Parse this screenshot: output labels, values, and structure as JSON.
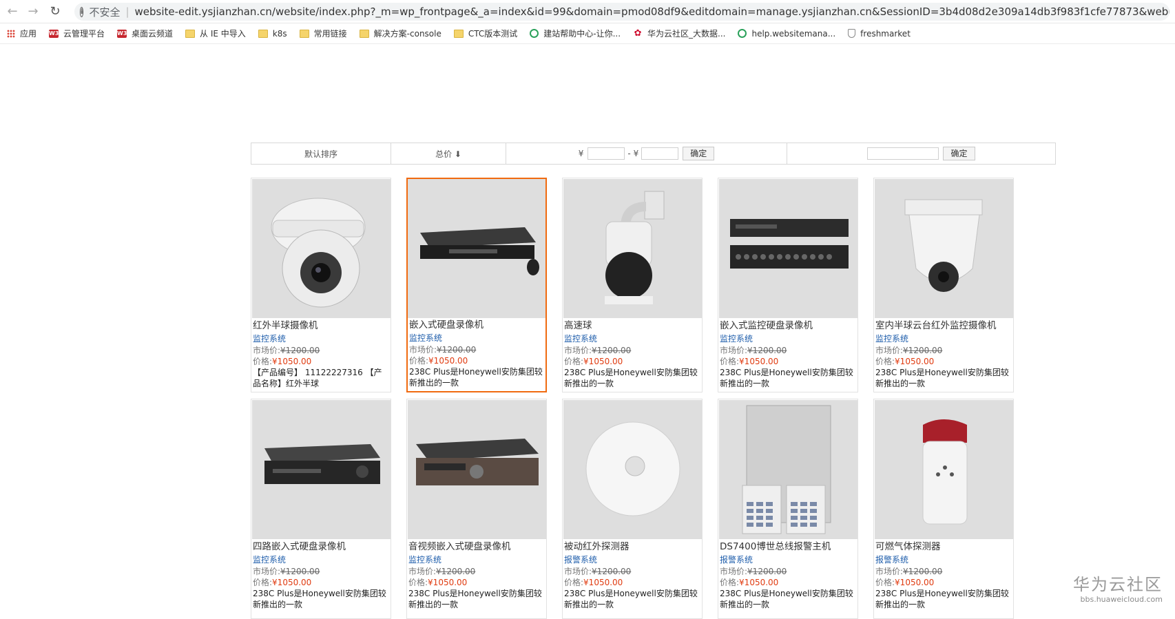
{
  "browser": {
    "insecure_label": "不安全",
    "url": "website-edit.ysjianzhan.cn/website/index.php?_m=wp_frontpage&_a=index&id=99&domain=pmod08df9&editdomain=manage.ysjianzhan.cn&SessionID=3b4d08d2e309a14db3f983f1cfe77873&webmtype=&_v=preview"
  },
  "bookmarks": [
    {
      "label": "应用",
      "icon": "apps-icon"
    },
    {
      "label": "云管理平台",
      "icon": "w3-icon"
    },
    {
      "label": "桌面云频道",
      "icon": "w3-icon"
    },
    {
      "label": "从 IE 中导入",
      "icon": "folder-icon"
    },
    {
      "label": "k8s",
      "icon": "folder-icon"
    },
    {
      "label": "常用链接",
      "icon": "folder-icon"
    },
    {
      "label": "解决方案-console",
      "icon": "folder-icon"
    },
    {
      "label": "CTC版本测试",
      "icon": "folder-icon"
    },
    {
      "label": "建站帮助中心-让你...",
      "icon": "search-icon"
    },
    {
      "label": "华为云社区_大数据...",
      "icon": "huawei-icon"
    },
    {
      "label": "help.websitemana...",
      "icon": "search-icon"
    },
    {
      "label": "freshmarket",
      "icon": "shield-icon"
    }
  ],
  "filter": {
    "default_sort": "默认排序",
    "total_price": "总价 ⬇",
    "currency_from": "¥",
    "currency_to": "- ¥",
    "confirm_price": "确定",
    "confirm_search": "确定"
  },
  "products": [
    {
      "name": "红外半球摄像机",
      "category": "监控系统",
      "market_label": "市场价:",
      "market_price": "¥1200.00",
      "price_label": "价格:",
      "price": "¥1050.00",
      "desc": "【产品编号】 11122227316 【产品名称】红外半球",
      "image": "dome-camera"
    },
    {
      "name": "嵌入式硬盘录像机",
      "category": "监控系统",
      "market_label": "市场价:",
      "market_price": "¥1200.00",
      "price_label": "价格:",
      "price": "¥1050.00",
      "desc": "238C Plus是Honeywell安防集团较新推出的一款",
      "image": "dvr-mouse"
    },
    {
      "name": "高速球",
      "category": "监控系统",
      "market_label": "市场价:",
      "market_price": "¥1200.00",
      "price_label": "价格:",
      "price": "¥1050.00",
      "desc": "238C Plus是Honeywell安防集团较新推出的一款",
      "image": "speed-dome"
    },
    {
      "name": "嵌入式监控硬盘录像机",
      "category": "监控系统",
      "market_label": "市场价:",
      "market_price": "¥1200.00",
      "price_label": "价格:",
      "price": "¥1050.00",
      "desc": "238C Plus是Honeywell安防集团较新推出的一款",
      "image": "dvr-stack"
    },
    {
      "name": "室内半球云台红外监控摄像机",
      "category": "监控系统",
      "market_label": "市场价:",
      "market_price": "¥1200.00",
      "price_label": "价格:",
      "price": "¥1050.00",
      "desc": "238C Plus是Honeywell安防集团较新推出的一款",
      "image": "indoor-camera"
    },
    {
      "name": "四路嵌入式硬盘录像机",
      "category": "监控系统",
      "market_label": "市场价:",
      "market_price": "¥1200.00",
      "price_label": "价格:",
      "price": "¥1050.00",
      "desc": "238C Plus是Honeywell安防集团较新推出的一款",
      "image": "dvr-black"
    },
    {
      "name": "音视频嵌入式硬盘录像机",
      "category": "监控系统",
      "market_label": "市场价:",
      "market_price": "¥1200.00",
      "price_label": "价格:",
      "price": "¥1050.00",
      "desc": "238C Plus是Honeywell安防集团较新推出的一款",
      "image": "dvr-bronze"
    },
    {
      "name": "被动红外探测器",
      "category": "报警系统",
      "market_label": "市场价:",
      "market_price": "¥1200.00",
      "price_label": "价格:",
      "price": "¥1050.00",
      "desc": "238C Plus是Honeywell安防集团较新推出的一款",
      "image": "pir-detector"
    },
    {
      "name": "DS7400博世总线报警主机",
      "category": "报警系统",
      "market_label": "市场价:",
      "market_price": "¥1200.00",
      "price_label": "价格:",
      "price": "¥1050.00",
      "desc": "238C Plus是Honeywell安防集团较新推出的一款",
      "image": "alarm-panel"
    },
    {
      "name": "可燃气体探测器",
      "category": "报警系统",
      "market_label": "市场价:",
      "market_price": "¥1200.00",
      "price_label": "价格:",
      "price": "¥1050.00",
      "desc": "238C Plus是Honeywell安防集团较新推出的一款",
      "image": "gas-detector"
    }
  ],
  "watermark": {
    "title": "华为云社区",
    "subtitle": "bbs.huaweicloud.com"
  },
  "colors": {
    "accent_border": "#f06a0f",
    "price_red": "#e03b10",
    "category_blue": "#1e5dab"
  }
}
